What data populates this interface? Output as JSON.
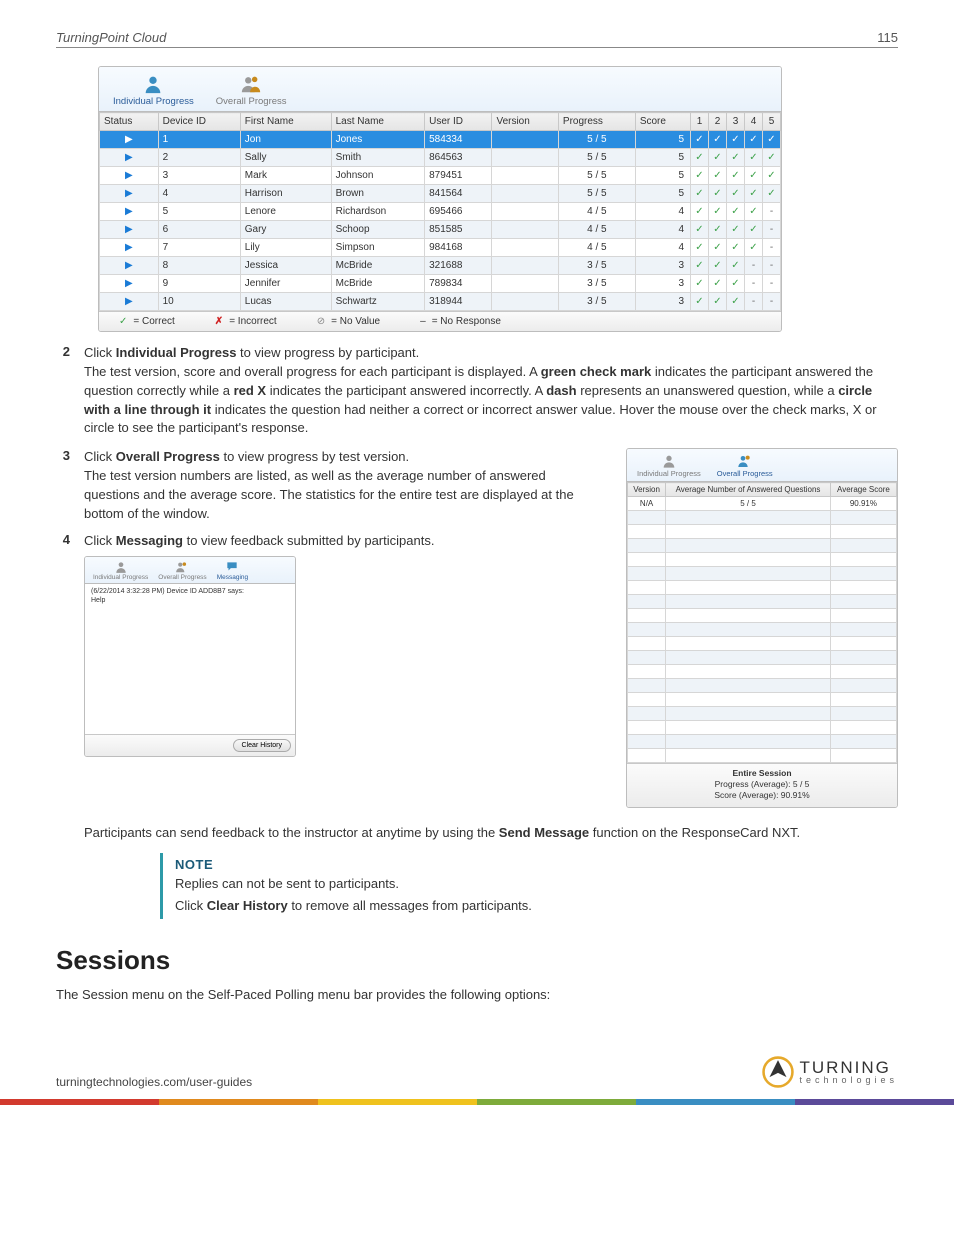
{
  "header": {
    "title": "TurningPoint Cloud",
    "page": "115"
  },
  "ip_panel": {
    "tabs": {
      "individual": "Individual Progress",
      "overall": "Overall Progress"
    },
    "columns": [
      "Status",
      "Device ID",
      "First Name",
      "Last Name",
      "User ID",
      "Version",
      "Progress",
      "Score",
      "1",
      "2",
      "3",
      "4",
      "5"
    ],
    "rows": [
      {
        "sel": true,
        "device": "1",
        "fn": "Jon",
        "ln": "Jones",
        "uid": "584334",
        "ver": "",
        "prog": "5 / 5",
        "score": "5",
        "q": [
          "✓",
          "✓",
          "✓",
          "✓",
          "✓"
        ]
      },
      {
        "sel": false,
        "device": "2",
        "fn": "Sally",
        "ln": "Smith",
        "uid": "864563",
        "ver": "",
        "prog": "5 / 5",
        "score": "5",
        "q": [
          "✓",
          "✓",
          "✓",
          "✓",
          "✓"
        ]
      },
      {
        "sel": false,
        "device": "3",
        "fn": "Mark",
        "ln": "Johnson",
        "uid": "879451",
        "ver": "",
        "prog": "5 / 5",
        "score": "5",
        "q": [
          "✓",
          "✓",
          "✓",
          "✓",
          "✓"
        ]
      },
      {
        "sel": false,
        "device": "4",
        "fn": "Harrison",
        "ln": "Brown",
        "uid": "841564",
        "ver": "",
        "prog": "5 / 5",
        "score": "5",
        "q": [
          "✓",
          "✓",
          "✓",
          "✓",
          "✓"
        ]
      },
      {
        "sel": false,
        "device": "5",
        "fn": "Lenore",
        "ln": "Richardson",
        "uid": "695466",
        "ver": "",
        "prog": "4 / 5",
        "score": "4",
        "q": [
          "✓",
          "✓",
          "✓",
          "✓",
          "-"
        ]
      },
      {
        "sel": false,
        "device": "6",
        "fn": "Gary",
        "ln": "Schoop",
        "uid": "851585",
        "ver": "",
        "prog": "4 / 5",
        "score": "4",
        "q": [
          "✓",
          "✓",
          "✓",
          "✓",
          "-"
        ]
      },
      {
        "sel": false,
        "device": "7",
        "fn": "Lily",
        "ln": "Simpson",
        "uid": "984168",
        "ver": "",
        "prog": "4 / 5",
        "score": "4",
        "q": [
          "✓",
          "✓",
          "✓",
          "✓",
          "-"
        ]
      },
      {
        "sel": false,
        "device": "8",
        "fn": "Jessica",
        "ln": "McBride",
        "uid": "321688",
        "ver": "",
        "prog": "3 / 5",
        "score": "3",
        "q": [
          "✓",
          "✓",
          "✓",
          "-",
          "-"
        ]
      },
      {
        "sel": false,
        "device": "9",
        "fn": "Jennifer",
        "ln": "McBride",
        "uid": "789834",
        "ver": "",
        "prog": "3 / 5",
        "score": "3",
        "q": [
          "✓",
          "✓",
          "✓",
          "-",
          "-"
        ]
      },
      {
        "sel": false,
        "device": "10",
        "fn": "Lucas",
        "ln": "Schwartz",
        "uid": "318944",
        "ver": "",
        "prog": "3 / 5",
        "score": "3",
        "q": [
          "✓",
          "✓",
          "✓",
          "-",
          "-"
        ]
      }
    ],
    "legend": {
      "correct": "= Correct",
      "incorrect": "= Incorrect",
      "novalue": "= No Value",
      "noresp": "= No Response"
    }
  },
  "steps": {
    "s2_lead": "Click ",
    "s2_b": "Individual Progress",
    "s2_tail": " to view progress by participant.",
    "s2_p_a": "The test version, score and overall progress for each participant is displayed. A ",
    "s2_b1": "green check mark",
    "s2_p_b": " indicates the participant answered the question correctly while a ",
    "s2_b2": "red X",
    "s2_p_c": " indicates the participant answered incorrectly. A ",
    "s2_b3": "dash",
    "s2_p_d": " represents an unanswered question, while a ",
    "s2_b4": "circle with a line through it",
    "s2_p_e": " indicates the question had neither a correct or incorrect answer value. Hover the mouse over the check marks, X or circle to see the participant's response.",
    "s3_lead": "Click ",
    "s3_b": "Overall Progress",
    "s3_tail": " to view progress by test version.",
    "s3_p": "The test version numbers are listed, as well as the average number of answered questions and the average score. The statistics for the entire test are displayed at the bottom of the window.",
    "s4_lead": "Click ",
    "s4_b": "Messaging",
    "s4_tail": " to view feedback submitted by participants."
  },
  "op_panel": {
    "tabs": {
      "individual": "Individual Progress",
      "overall": "Overall Progress"
    },
    "columns": [
      "Version",
      "Average Number of Answered Questions",
      "Average Score"
    ],
    "row": {
      "v": "N/A",
      "avg": "5 / 5",
      "score": "90.91%"
    },
    "blank_rows": 18,
    "footer": {
      "t1": "Entire Session",
      "t2": "Progress (Average):  5 / 5",
      "t3": "Score (Average): 90.91%"
    }
  },
  "msg_panel": {
    "tabs": {
      "individual": "Individual Progress",
      "overall": "Overall Progress",
      "messaging": "Messaging"
    },
    "line1": "(6/22/2014 3:32:28 PM) Device ID ADD8B7 says:",
    "line2": "Help",
    "clear": "Clear History"
  },
  "after_msg_a": "Participants can send feedback to the instructor at anytime by using the ",
  "after_msg_b": "Send Message",
  "after_msg_c": " function on the ResponseCard NXT.",
  "note": {
    "label": "NOTE",
    "l1": "Replies can not be sent to participants.",
    "l2a": "Click ",
    "l2b": "Clear History",
    "l2c": " to remove all messages from participants."
  },
  "section": {
    "title": "Sessions",
    "para": "The Session menu on the Self-Paced Polling menu bar provides the following options:"
  },
  "footer": {
    "url": "turningtechnologies.com/user-guides",
    "brand1": "TURNING",
    "brand2": "technologies"
  }
}
